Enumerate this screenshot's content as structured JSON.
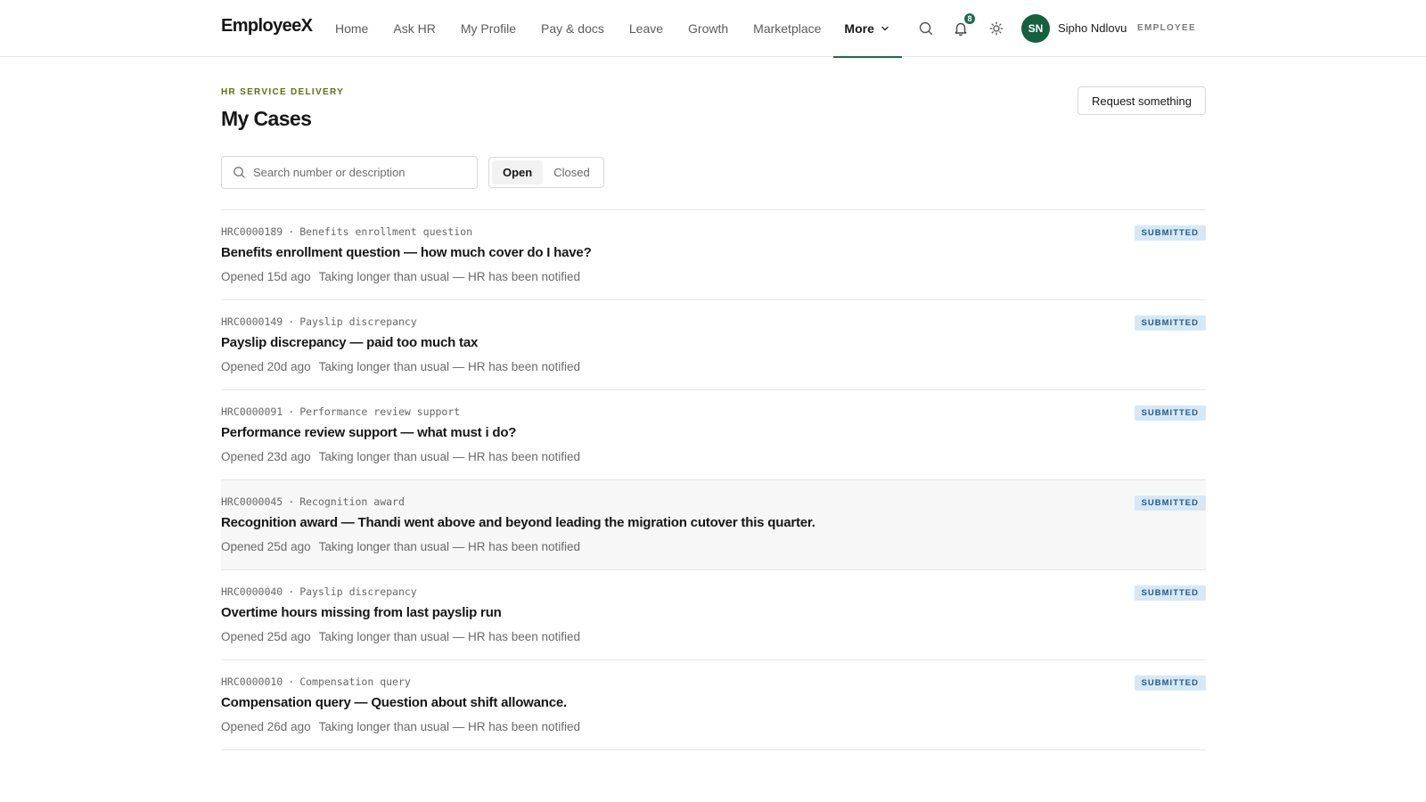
{
  "app": {
    "logo": "EmployeeX"
  },
  "nav": {
    "items": [
      {
        "label": "Home"
      },
      {
        "label": "Ask HR"
      },
      {
        "label": "My Profile"
      },
      {
        "label": "Pay & docs"
      },
      {
        "label": "Leave"
      },
      {
        "label": "Growth"
      },
      {
        "label": "Marketplace"
      },
      {
        "label": "More"
      }
    ],
    "active": "More",
    "notifications_count": "8"
  },
  "user": {
    "initials": "SN",
    "name": "Sipho Ndlovu",
    "role": "EMPLOYEE"
  },
  "header": {
    "eyebrow": "HR SERVICE DELIVERY",
    "title": "My Cases",
    "request_button": "Request something"
  },
  "filters": {
    "search_placeholder": "Search number or description",
    "segments": [
      "Open",
      "Closed"
    ],
    "active_segment": "Open"
  },
  "cases": [
    {
      "number": "HRC0000189",
      "category": "Benefits enrollment question",
      "title": "Benefits enrollment question — how much cover do I have?",
      "opened": "Opened 15d ago",
      "notice": "Taking longer than usual — HR has been notified",
      "status": "SUBMITTED"
    },
    {
      "number": "HRC0000149",
      "category": "Payslip discrepancy",
      "title": "Payslip discrepancy — paid too much tax",
      "opened": "Opened 20d ago",
      "notice": "Taking longer than usual — HR has been notified",
      "status": "SUBMITTED"
    },
    {
      "number": "HRC0000091",
      "category": "Performance review support",
      "title": "Performance review support — what must i do?",
      "opened": "Opened 23d ago",
      "notice": "Taking longer than usual — HR has been notified",
      "status": "SUBMITTED"
    },
    {
      "number": "HRC0000045",
      "category": "Recognition award",
      "title": "Recognition award — Thandi went above and beyond leading the migration cutover this quarter.",
      "opened": "Opened 25d ago",
      "notice": "Taking longer than usual — HR has been notified",
      "status": "SUBMITTED"
    },
    {
      "number": "HRC0000040",
      "category": "Payslip discrepancy",
      "title": "Overtime hours missing from last payslip run",
      "opened": "Opened 25d ago",
      "notice": "Taking longer than usual — HR has been notified",
      "status": "SUBMITTED"
    },
    {
      "number": "HRC0000010",
      "category": "Compensation query",
      "title": "Compensation query — Question about shift allowance.",
      "opened": "Opened 26d ago",
      "notice": "Taking longer than usual — HR has been notified",
      "status": "SUBMITTED"
    }
  ],
  "colors": {
    "accent": "#1e6b4a",
    "eyebrow": "#5f6f12",
    "status_bg": "#d6e8f6",
    "status_text": "#1f5a8a"
  },
  "icons": {
    "search": "search-icon",
    "notifications": "bell-icon",
    "theme": "sun-icon",
    "more_chevron": "chevron-down-icon"
  }
}
